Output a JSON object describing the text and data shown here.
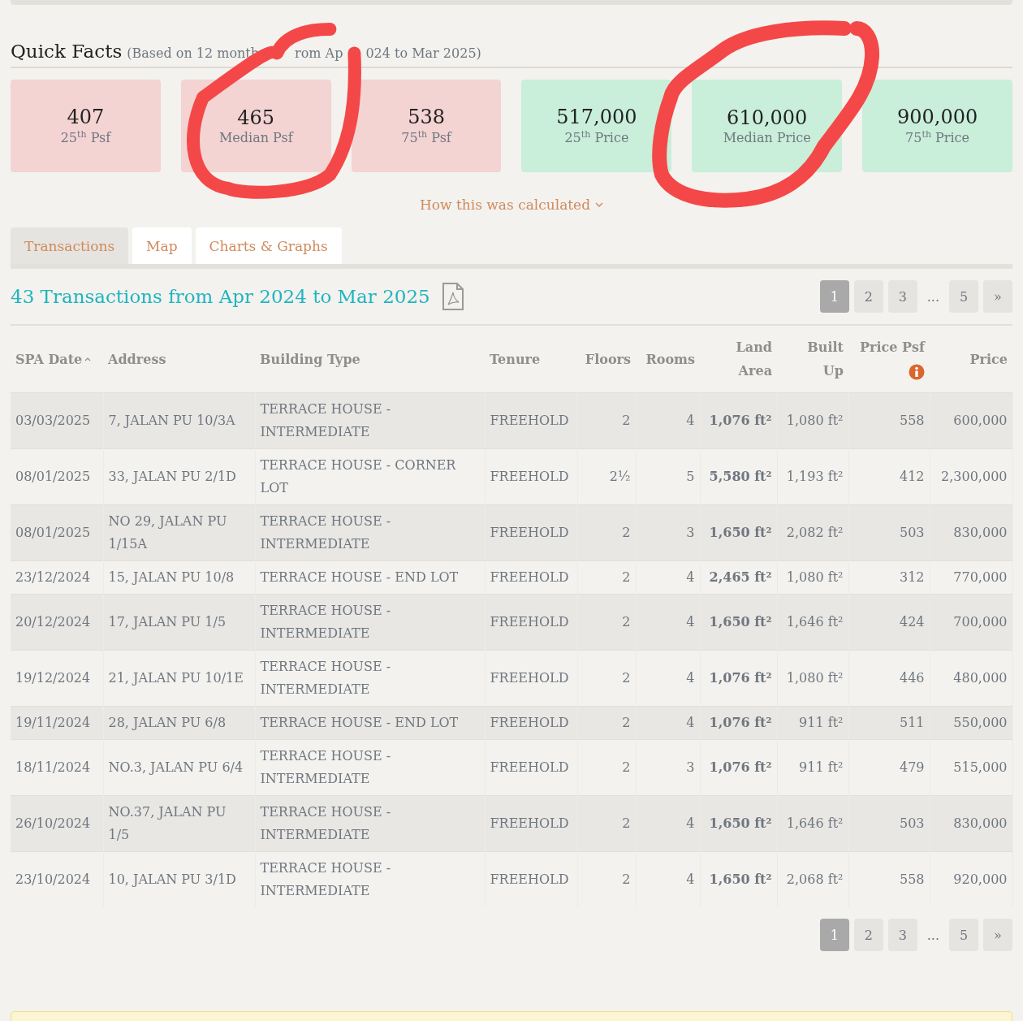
{
  "quick_facts": {
    "title": "Quick Facts",
    "subtitle_parts": [
      "(Based on 12 month",
      "rom Ap",
      "024 to Mar 2025)"
    ],
    "cards": [
      {
        "kind": "psf",
        "value": "407",
        "label": "25$^{th}$ Psf"
      },
      {
        "kind": "psf",
        "value": "465",
        "label": "Median Psf"
      },
      {
        "kind": "psf",
        "value": "538",
        "label": "75$^{th}$ Psf"
      },
      {
        "kind": "price",
        "value": "517,000",
        "label": "25$^{th}$ Price"
      },
      {
        "kind": "price",
        "value": "610,000",
        "label": "Median Price"
      },
      {
        "kind": "price",
        "value": "900,000",
        "label": "75$^{th}$ Price"
      }
    ],
    "calc_link": "How this was calculated"
  },
  "tabs": [
    {
      "label": "Transactions",
      "selected": true
    },
    {
      "label": "Map",
      "selected": false
    },
    {
      "label": "Charts & Graphs",
      "selected": false
    }
  ],
  "heading": "43 Transactions from Apr 2024 to Mar 2025",
  "pagination_top": [
    {
      "kind": "page",
      "label": "1",
      "selected": true
    },
    {
      "kind": "page",
      "label": "2",
      "selected": false
    },
    {
      "kind": "page",
      "label": "3",
      "selected": false
    },
    {
      "kind": "gap",
      "label": "..."
    },
    {
      "kind": "page",
      "label": "5",
      "selected": false
    },
    {
      "kind": "page",
      "label": "»",
      "selected": false
    }
  ],
  "table": {
    "columns": [
      "SPA Date",
      "Address",
      "Building Type",
      "Tenure",
      "Floors",
      "Rooms",
      "Land Area",
      "Built Up",
      "Price Psf",
      "Price"
    ],
    "rows": [
      [
        "03/03/2025",
        "7, JALAN PU 10/3A",
        "TERRACE HOUSE - INTERMEDIATE",
        "FREEHOLD",
        "2",
        "4",
        "1,076 ft²",
        "1,080 ft²",
        "558",
        "600,000"
      ],
      [
        "08/01/2025",
        "33, JALAN PU 2/1D",
        "TERRACE HOUSE - CORNER LOT",
        "FREEHOLD",
        "2½",
        "5",
        "5,580 ft²",
        "1,193 ft²",
        "412",
        "2,300,000"
      ],
      [
        "08/01/2025",
        "NO 29, JALAN PU 1/15A",
        "TERRACE HOUSE - INTERMEDIATE",
        "FREEHOLD",
        "2",
        "3",
        "1,650 ft²",
        "2,082 ft²",
        "503",
        "830,000"
      ],
      [
        "23/12/2024",
        "15, JALAN PU 10/8",
        "TERRACE HOUSE - END LOT",
        "FREEHOLD",
        "2",
        "4",
        "2,465 ft²",
        "1,080 ft²",
        "312",
        "770,000"
      ],
      [
        "20/12/2024",
        "17, JALAN PU 1/5",
        "TERRACE HOUSE - INTERMEDIATE",
        "FREEHOLD",
        "2",
        "4",
        "1,650 ft²",
        "1,646 ft²",
        "424",
        "700,000"
      ],
      [
        "19/12/2024",
        "21, JALAN PU 10/1E",
        "TERRACE HOUSE - INTERMEDIATE",
        "FREEHOLD",
        "2",
        "4",
        "1,076 ft²",
        "1,080 ft²",
        "446",
        "480,000"
      ],
      [
        "19/11/2024",
        "28, JALAN PU 6/8",
        "TERRACE HOUSE - END LOT",
        "FREEHOLD",
        "2",
        "4",
        "1,076 ft²",
        "911 ft²",
        "511",
        "550,000"
      ],
      [
        "18/11/2024",
        "NO.3, JALAN PU 6/4",
        "TERRACE HOUSE - INTERMEDIATE",
        "FREEHOLD",
        "2",
        "3",
        "1,076 ft²",
        "911 ft²",
        "479",
        "515,000"
      ],
      [
        "26/10/2024",
        "NO.37, JALAN PU 1/5",
        "TERRACE HOUSE - INTERMEDIATE",
        "FREEHOLD",
        "2",
        "4",
        "1,650 ft²",
        "1,646 ft²",
        "503",
        "830,000"
      ],
      [
        "23/10/2024",
        "10, JALAN PU 3/1D",
        "TERRACE HOUSE - INTERMEDIATE",
        "FREEHOLD",
        "2",
        "4",
        "1,650 ft²",
        "2,068 ft²",
        "558",
        "920,000"
      ]
    ]
  },
  "pagination_bottom": [
    {
      "kind": "page",
      "label": "1",
      "selected": true
    },
    {
      "kind": "page",
      "label": "2",
      "selected": false
    },
    {
      "kind": "page",
      "label": "3",
      "selected": false
    },
    {
      "kind": "gap",
      "label": "..."
    },
    {
      "kind": "page",
      "label": "5",
      "selected": false
    },
    {
      "kind": "page",
      "label": "»",
      "selected": false
    }
  ]
}
